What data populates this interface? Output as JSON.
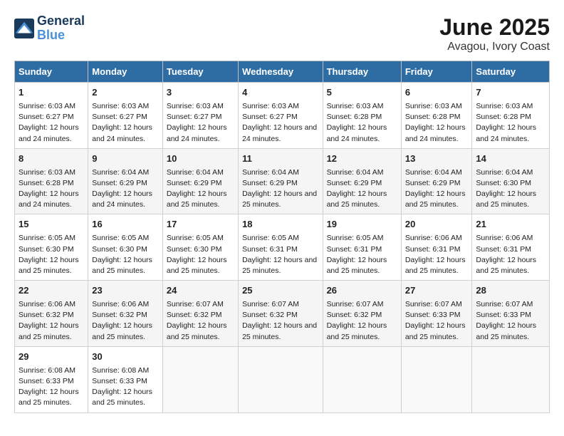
{
  "header": {
    "logo_line1": "General",
    "logo_line2": "Blue",
    "title": "June 2025",
    "subtitle": "Avagou, Ivory Coast"
  },
  "days_of_week": [
    "Sunday",
    "Monday",
    "Tuesday",
    "Wednesday",
    "Thursday",
    "Friday",
    "Saturday"
  ],
  "weeks": [
    [
      {
        "day": "1",
        "info": "Sunrise: 6:03 AM\nSunset: 6:27 PM\nDaylight: 12 hours and 24 minutes."
      },
      {
        "day": "2",
        "info": "Sunrise: 6:03 AM\nSunset: 6:27 PM\nDaylight: 12 hours and 24 minutes."
      },
      {
        "day": "3",
        "info": "Sunrise: 6:03 AM\nSunset: 6:27 PM\nDaylight: 12 hours and 24 minutes."
      },
      {
        "day": "4",
        "info": "Sunrise: 6:03 AM\nSunset: 6:27 PM\nDaylight: 12 hours and 24 minutes."
      },
      {
        "day": "5",
        "info": "Sunrise: 6:03 AM\nSunset: 6:28 PM\nDaylight: 12 hours and 24 minutes."
      },
      {
        "day": "6",
        "info": "Sunrise: 6:03 AM\nSunset: 6:28 PM\nDaylight: 12 hours and 24 minutes."
      },
      {
        "day": "7",
        "info": "Sunrise: 6:03 AM\nSunset: 6:28 PM\nDaylight: 12 hours and 24 minutes."
      }
    ],
    [
      {
        "day": "8",
        "info": "Sunrise: 6:03 AM\nSunset: 6:28 PM\nDaylight: 12 hours and 24 minutes."
      },
      {
        "day": "9",
        "info": "Sunrise: 6:04 AM\nSunset: 6:29 PM\nDaylight: 12 hours and 24 minutes."
      },
      {
        "day": "10",
        "info": "Sunrise: 6:04 AM\nSunset: 6:29 PM\nDaylight: 12 hours and 25 minutes."
      },
      {
        "day": "11",
        "info": "Sunrise: 6:04 AM\nSunset: 6:29 PM\nDaylight: 12 hours and 25 minutes."
      },
      {
        "day": "12",
        "info": "Sunrise: 6:04 AM\nSunset: 6:29 PM\nDaylight: 12 hours and 25 minutes."
      },
      {
        "day": "13",
        "info": "Sunrise: 6:04 AM\nSunset: 6:29 PM\nDaylight: 12 hours and 25 minutes."
      },
      {
        "day": "14",
        "info": "Sunrise: 6:04 AM\nSunset: 6:30 PM\nDaylight: 12 hours and 25 minutes."
      }
    ],
    [
      {
        "day": "15",
        "info": "Sunrise: 6:05 AM\nSunset: 6:30 PM\nDaylight: 12 hours and 25 minutes."
      },
      {
        "day": "16",
        "info": "Sunrise: 6:05 AM\nSunset: 6:30 PM\nDaylight: 12 hours and 25 minutes."
      },
      {
        "day": "17",
        "info": "Sunrise: 6:05 AM\nSunset: 6:30 PM\nDaylight: 12 hours and 25 minutes."
      },
      {
        "day": "18",
        "info": "Sunrise: 6:05 AM\nSunset: 6:31 PM\nDaylight: 12 hours and 25 minutes."
      },
      {
        "day": "19",
        "info": "Sunrise: 6:05 AM\nSunset: 6:31 PM\nDaylight: 12 hours and 25 minutes."
      },
      {
        "day": "20",
        "info": "Sunrise: 6:06 AM\nSunset: 6:31 PM\nDaylight: 12 hours and 25 minutes."
      },
      {
        "day": "21",
        "info": "Sunrise: 6:06 AM\nSunset: 6:31 PM\nDaylight: 12 hours and 25 minutes."
      }
    ],
    [
      {
        "day": "22",
        "info": "Sunrise: 6:06 AM\nSunset: 6:32 PM\nDaylight: 12 hours and 25 minutes."
      },
      {
        "day": "23",
        "info": "Sunrise: 6:06 AM\nSunset: 6:32 PM\nDaylight: 12 hours and 25 minutes."
      },
      {
        "day": "24",
        "info": "Sunrise: 6:07 AM\nSunset: 6:32 PM\nDaylight: 12 hours and 25 minutes."
      },
      {
        "day": "25",
        "info": "Sunrise: 6:07 AM\nSunset: 6:32 PM\nDaylight: 12 hours and 25 minutes."
      },
      {
        "day": "26",
        "info": "Sunrise: 6:07 AM\nSunset: 6:32 PM\nDaylight: 12 hours and 25 minutes."
      },
      {
        "day": "27",
        "info": "Sunrise: 6:07 AM\nSunset: 6:33 PM\nDaylight: 12 hours and 25 minutes."
      },
      {
        "day": "28",
        "info": "Sunrise: 6:07 AM\nSunset: 6:33 PM\nDaylight: 12 hours and 25 minutes."
      }
    ],
    [
      {
        "day": "29",
        "info": "Sunrise: 6:08 AM\nSunset: 6:33 PM\nDaylight: 12 hours and 25 minutes."
      },
      {
        "day": "30",
        "info": "Sunrise: 6:08 AM\nSunset: 6:33 PM\nDaylight: 12 hours and 25 minutes."
      },
      {
        "day": "",
        "info": ""
      },
      {
        "day": "",
        "info": ""
      },
      {
        "day": "",
        "info": ""
      },
      {
        "day": "",
        "info": ""
      },
      {
        "day": "",
        "info": ""
      }
    ]
  ]
}
